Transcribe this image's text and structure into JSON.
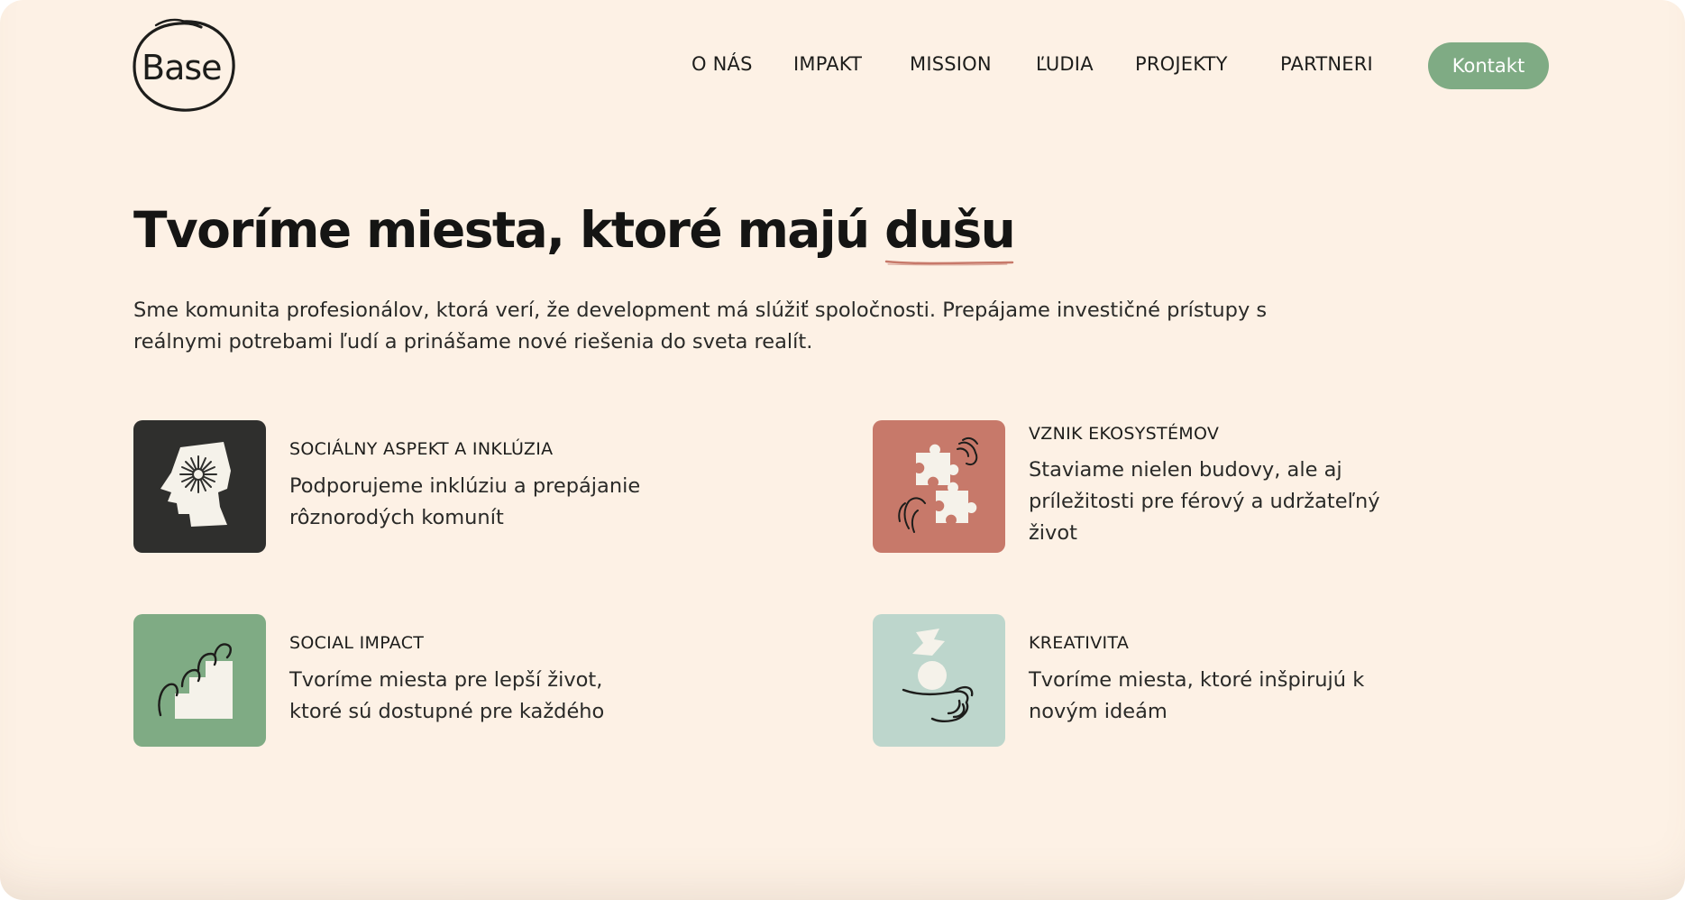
{
  "brand": {
    "logo_text": "Base"
  },
  "nav": {
    "items": [
      "O NÁS",
      "IMPAKT",
      "MISSION",
      "ĽUDIA",
      "PROJEKTY",
      "PARTNERI"
    ],
    "cta_label": "Kontakt"
  },
  "hero": {
    "title_main": "Tvoríme miesta, ktoré majú ",
    "title_accent": "dušu",
    "text": "Sme komunita profesionálov, ktorá verí, že development má slúžiť spoločnosti. Prepájame investičné prístupy s reálnymi potrebami ľudí a prinášame nové riešenia do sveta realít."
  },
  "features": [
    {
      "title": "SOCIÁLNY ASPEKT A INKLÚZIA",
      "text": [
        "Podporujeme inklúziu a prepájanie",
        "rôznorodých komunít"
      ],
      "icon": "head-icon",
      "color": "#2f2f2d"
    },
    {
      "title": "VZNIK EKOSYSTÉMOV",
      "text": [
        "Staviame nielen budovy, ale aj",
        "príležitosti pre férový a udržateľný",
        "život"
      ],
      "icon": "puzzle-hands-icon",
      "color": "#c7796a"
    },
    {
      "title": "SOCIAL IMPACT",
      "text": [
        "Tvoríme miesta pre lepší život,",
        "ktoré sú dostupné pre každého"
      ],
      "icon": "stairs-icon",
      "color": "#7fab84"
    },
    {
      "title": "KREATIVITA",
      "text": [
        "Tvoríme miesta, ktoré inšpirujú k",
        "novým ideám"
      ],
      "icon": "hand-shapes-icon",
      "color": "#bdd6cc"
    }
  ],
  "colors": {
    "background": "#fdf1e5",
    "accent": "#7fab84",
    "underline": "#c7796a"
  }
}
